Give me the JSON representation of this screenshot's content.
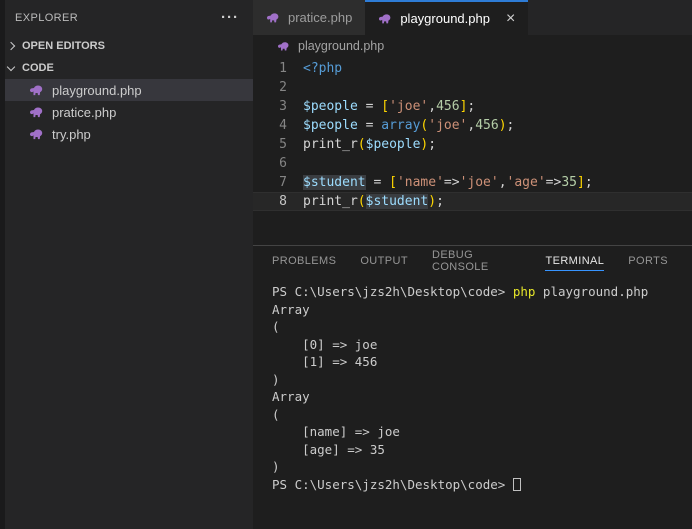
{
  "colors": {
    "accent": "#3794ff",
    "tab_top_border": "#2e7cd6",
    "sidebar_selection": "#37373d",
    "icon_purple": "#a070c8",
    "syntax": {
      "tag": "#569cd6",
      "keyword": "#569cd6",
      "variable": "#9cdcfe",
      "string": "#ce9178",
      "number": "#b5cea8",
      "bracket": "#ffd700",
      "function": "#d4d4d4",
      "default": "#d4d4d4"
    },
    "terminal": {
      "fg": "#cccccc",
      "cmd": "#e5e52a"
    }
  },
  "icons": {
    "close": "×",
    "more": "···"
  },
  "sidebar": {
    "title": "EXPLORER",
    "sections": [
      {
        "label": "OPEN EDITORS",
        "collapsed": true
      },
      {
        "label": "CODE",
        "collapsed": false
      }
    ],
    "files": [
      {
        "name": "playground.php",
        "selected": true
      },
      {
        "name": "pratice.php",
        "selected": false
      },
      {
        "name": "try.php",
        "selected": false
      }
    ]
  },
  "editor": {
    "tabs": [
      {
        "label": "pratice.php",
        "active": false
      },
      {
        "label": "playground.php",
        "active": true
      }
    ],
    "breadcrumb": "playground.php",
    "code_lines": [
      {
        "num": "1",
        "current": false,
        "tokens": [
          {
            "t": "<?php",
            "c": "tag"
          }
        ]
      },
      {
        "num": "2",
        "current": false,
        "tokens": []
      },
      {
        "num": "3",
        "current": false,
        "tokens": [
          {
            "t": "$people",
            "c": "variable"
          },
          {
            "t": " = ",
            "c": "default"
          },
          {
            "t": "[",
            "c": "bracket"
          },
          {
            "t": "'joe'",
            "c": "string"
          },
          {
            "t": ",",
            "c": "default"
          },
          {
            "t": "456",
            "c": "number"
          },
          {
            "t": "]",
            "c": "bracket"
          },
          {
            "t": ";",
            "c": "default"
          }
        ]
      },
      {
        "num": "4",
        "current": false,
        "tokens": [
          {
            "t": "$people",
            "c": "variable"
          },
          {
            "t": " = ",
            "c": "default"
          },
          {
            "t": "array",
            "c": "keyword"
          },
          {
            "t": "(",
            "c": "bracket"
          },
          {
            "t": "'joe'",
            "c": "string"
          },
          {
            "t": ",",
            "c": "default"
          },
          {
            "t": "456",
            "c": "number"
          },
          {
            "t": ")",
            "c": "bracket"
          },
          {
            "t": ";",
            "c": "default"
          }
        ]
      },
      {
        "num": "5",
        "current": false,
        "tokens": [
          {
            "t": "print_r",
            "c": "function"
          },
          {
            "t": "(",
            "c": "bracket"
          },
          {
            "t": "$people",
            "c": "variable"
          },
          {
            "t": ")",
            "c": "bracket"
          },
          {
            "t": ";",
            "c": "default"
          }
        ]
      },
      {
        "num": "6",
        "current": false,
        "tokens": []
      },
      {
        "num": "7",
        "current": false,
        "tokens": [
          {
            "t": "$student",
            "c": "variable",
            "hl": true
          },
          {
            "t": " = ",
            "c": "default"
          },
          {
            "t": "[",
            "c": "bracket"
          },
          {
            "t": "'name'",
            "c": "string"
          },
          {
            "t": "=>",
            "c": "default"
          },
          {
            "t": "'joe'",
            "c": "string"
          },
          {
            "t": ",",
            "c": "default"
          },
          {
            "t": "'age'",
            "c": "string"
          },
          {
            "t": "=>",
            "c": "default"
          },
          {
            "t": "35",
            "c": "number"
          },
          {
            "t": "]",
            "c": "bracket"
          },
          {
            "t": ";",
            "c": "default"
          }
        ]
      },
      {
        "num": "8",
        "current": true,
        "tokens": [
          {
            "t": "print_r",
            "c": "function"
          },
          {
            "t": "(",
            "c": "bracket"
          },
          {
            "t": "$student",
            "c": "variable",
            "hl": true
          },
          {
            "t": ")",
            "c": "bracket"
          },
          {
            "t": ";",
            "c": "default"
          }
        ]
      }
    ]
  },
  "panel": {
    "tabs": [
      {
        "label": "PROBLEMS",
        "active": false
      },
      {
        "label": "OUTPUT",
        "active": false
      },
      {
        "label": "DEBUG CONSOLE",
        "active": false
      },
      {
        "label": "TERMINAL",
        "active": true
      },
      {
        "label": "PORTS",
        "active": false
      }
    ],
    "terminal_lines": [
      {
        "tokens": [
          {
            "t": "PS C:\\Users\\jzs2h\\Desktop\\code> ",
            "c": "fg"
          },
          {
            "t": "php",
            "c": "cmd"
          },
          {
            "t": " playground.php",
            "c": "fg"
          }
        ]
      },
      {
        "tokens": [
          {
            "t": "Array",
            "c": "fg"
          }
        ]
      },
      {
        "tokens": [
          {
            "t": "(",
            "c": "fg"
          }
        ]
      },
      {
        "tokens": [
          {
            "t": "    [0] => joe",
            "c": "fg"
          }
        ]
      },
      {
        "tokens": [
          {
            "t": "    [1] => 456",
            "c": "fg"
          }
        ]
      },
      {
        "tokens": [
          {
            "t": ")",
            "c": "fg"
          }
        ]
      },
      {
        "tokens": [
          {
            "t": "Array",
            "c": "fg"
          }
        ]
      },
      {
        "tokens": [
          {
            "t": "(",
            "c": "fg"
          }
        ]
      },
      {
        "tokens": [
          {
            "t": "    [name] => joe",
            "c": "fg"
          }
        ]
      },
      {
        "tokens": [
          {
            "t": "    [age] => 35",
            "c": "fg"
          }
        ]
      },
      {
        "tokens": [
          {
            "t": ")",
            "c": "fg"
          }
        ]
      },
      {
        "tokens": [
          {
            "t": "PS C:\\Users\\jzs2h\\Desktop\\code> ",
            "c": "fg"
          }
        ],
        "cursor": true
      }
    ]
  }
}
